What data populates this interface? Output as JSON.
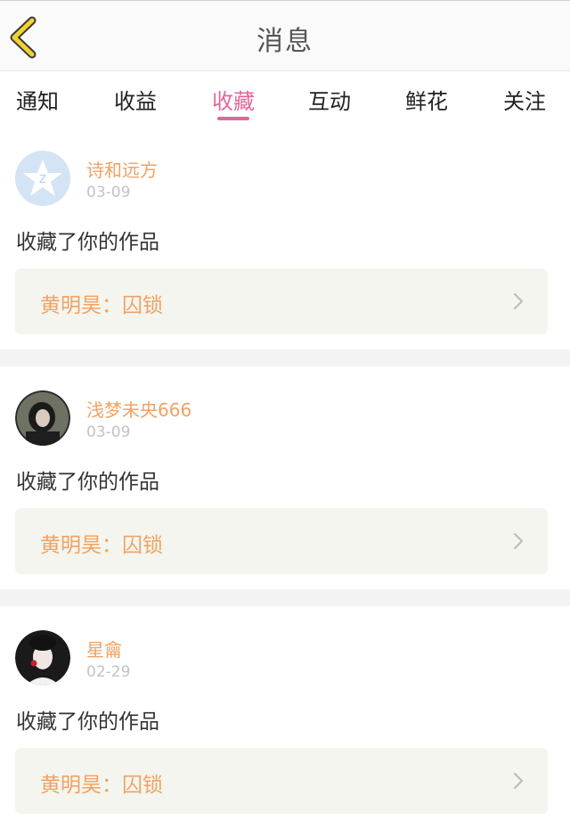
{
  "header": {
    "title": "消息"
  },
  "tabs": [
    {
      "label": "通知"
    },
    {
      "label": "收益"
    },
    {
      "label": "收藏",
      "active": true
    },
    {
      "label": "互动"
    },
    {
      "label": "鲜花"
    },
    {
      "label": "关注"
    }
  ],
  "items": [
    {
      "username": "诗和远方",
      "date": "03-09",
      "action": "收藏了你的作品",
      "work": "黄明昊：囚锁"
    },
    {
      "username": "浅梦未央666",
      "date": "03-09",
      "action": "收藏了你的作品",
      "work": "黄明昊：囚锁"
    },
    {
      "username": "星龠",
      "date": "02-29",
      "action": "收藏了你的作品",
      "work": "黄明昊：囚锁"
    }
  ],
  "colors": {
    "accent": "#e0679b",
    "username": "#f0a262",
    "back_icon": "#f2d22f"
  }
}
